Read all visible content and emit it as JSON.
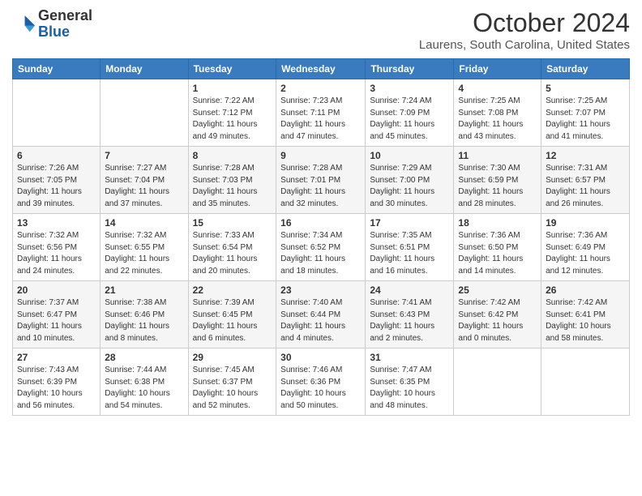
{
  "header": {
    "logo_line1": "General",
    "logo_line2": "Blue",
    "month_title": "October 2024",
    "location": "Laurens, South Carolina, United States"
  },
  "days_of_week": [
    "Sunday",
    "Monday",
    "Tuesday",
    "Wednesday",
    "Thursday",
    "Friday",
    "Saturday"
  ],
  "weeks": [
    [
      {
        "day": "",
        "info": ""
      },
      {
        "day": "",
        "info": ""
      },
      {
        "day": "1",
        "info": "Sunrise: 7:22 AM\nSunset: 7:12 PM\nDaylight: 11 hours and 49 minutes."
      },
      {
        "day": "2",
        "info": "Sunrise: 7:23 AM\nSunset: 7:11 PM\nDaylight: 11 hours and 47 minutes."
      },
      {
        "day": "3",
        "info": "Sunrise: 7:24 AM\nSunset: 7:09 PM\nDaylight: 11 hours and 45 minutes."
      },
      {
        "day": "4",
        "info": "Sunrise: 7:25 AM\nSunset: 7:08 PM\nDaylight: 11 hours and 43 minutes."
      },
      {
        "day": "5",
        "info": "Sunrise: 7:25 AM\nSunset: 7:07 PM\nDaylight: 11 hours and 41 minutes."
      }
    ],
    [
      {
        "day": "6",
        "info": "Sunrise: 7:26 AM\nSunset: 7:05 PM\nDaylight: 11 hours and 39 minutes."
      },
      {
        "day": "7",
        "info": "Sunrise: 7:27 AM\nSunset: 7:04 PM\nDaylight: 11 hours and 37 minutes."
      },
      {
        "day": "8",
        "info": "Sunrise: 7:28 AM\nSunset: 7:03 PM\nDaylight: 11 hours and 35 minutes."
      },
      {
        "day": "9",
        "info": "Sunrise: 7:28 AM\nSunset: 7:01 PM\nDaylight: 11 hours and 32 minutes."
      },
      {
        "day": "10",
        "info": "Sunrise: 7:29 AM\nSunset: 7:00 PM\nDaylight: 11 hours and 30 minutes."
      },
      {
        "day": "11",
        "info": "Sunrise: 7:30 AM\nSunset: 6:59 PM\nDaylight: 11 hours and 28 minutes."
      },
      {
        "day": "12",
        "info": "Sunrise: 7:31 AM\nSunset: 6:57 PM\nDaylight: 11 hours and 26 minutes."
      }
    ],
    [
      {
        "day": "13",
        "info": "Sunrise: 7:32 AM\nSunset: 6:56 PM\nDaylight: 11 hours and 24 minutes."
      },
      {
        "day": "14",
        "info": "Sunrise: 7:32 AM\nSunset: 6:55 PM\nDaylight: 11 hours and 22 minutes."
      },
      {
        "day": "15",
        "info": "Sunrise: 7:33 AM\nSunset: 6:54 PM\nDaylight: 11 hours and 20 minutes."
      },
      {
        "day": "16",
        "info": "Sunrise: 7:34 AM\nSunset: 6:52 PM\nDaylight: 11 hours and 18 minutes."
      },
      {
        "day": "17",
        "info": "Sunrise: 7:35 AM\nSunset: 6:51 PM\nDaylight: 11 hours and 16 minutes."
      },
      {
        "day": "18",
        "info": "Sunrise: 7:36 AM\nSunset: 6:50 PM\nDaylight: 11 hours and 14 minutes."
      },
      {
        "day": "19",
        "info": "Sunrise: 7:36 AM\nSunset: 6:49 PM\nDaylight: 11 hours and 12 minutes."
      }
    ],
    [
      {
        "day": "20",
        "info": "Sunrise: 7:37 AM\nSunset: 6:47 PM\nDaylight: 11 hours and 10 minutes."
      },
      {
        "day": "21",
        "info": "Sunrise: 7:38 AM\nSunset: 6:46 PM\nDaylight: 11 hours and 8 minutes."
      },
      {
        "day": "22",
        "info": "Sunrise: 7:39 AM\nSunset: 6:45 PM\nDaylight: 11 hours and 6 minutes."
      },
      {
        "day": "23",
        "info": "Sunrise: 7:40 AM\nSunset: 6:44 PM\nDaylight: 11 hours and 4 minutes."
      },
      {
        "day": "24",
        "info": "Sunrise: 7:41 AM\nSunset: 6:43 PM\nDaylight: 11 hours and 2 minutes."
      },
      {
        "day": "25",
        "info": "Sunrise: 7:42 AM\nSunset: 6:42 PM\nDaylight: 11 hours and 0 minutes."
      },
      {
        "day": "26",
        "info": "Sunrise: 7:42 AM\nSunset: 6:41 PM\nDaylight: 10 hours and 58 minutes."
      }
    ],
    [
      {
        "day": "27",
        "info": "Sunrise: 7:43 AM\nSunset: 6:39 PM\nDaylight: 10 hours and 56 minutes."
      },
      {
        "day": "28",
        "info": "Sunrise: 7:44 AM\nSunset: 6:38 PM\nDaylight: 10 hours and 54 minutes."
      },
      {
        "day": "29",
        "info": "Sunrise: 7:45 AM\nSunset: 6:37 PM\nDaylight: 10 hours and 52 minutes."
      },
      {
        "day": "30",
        "info": "Sunrise: 7:46 AM\nSunset: 6:36 PM\nDaylight: 10 hours and 50 minutes."
      },
      {
        "day": "31",
        "info": "Sunrise: 7:47 AM\nSunset: 6:35 PM\nDaylight: 10 hours and 48 minutes."
      },
      {
        "day": "",
        "info": ""
      },
      {
        "day": "",
        "info": ""
      }
    ]
  ]
}
